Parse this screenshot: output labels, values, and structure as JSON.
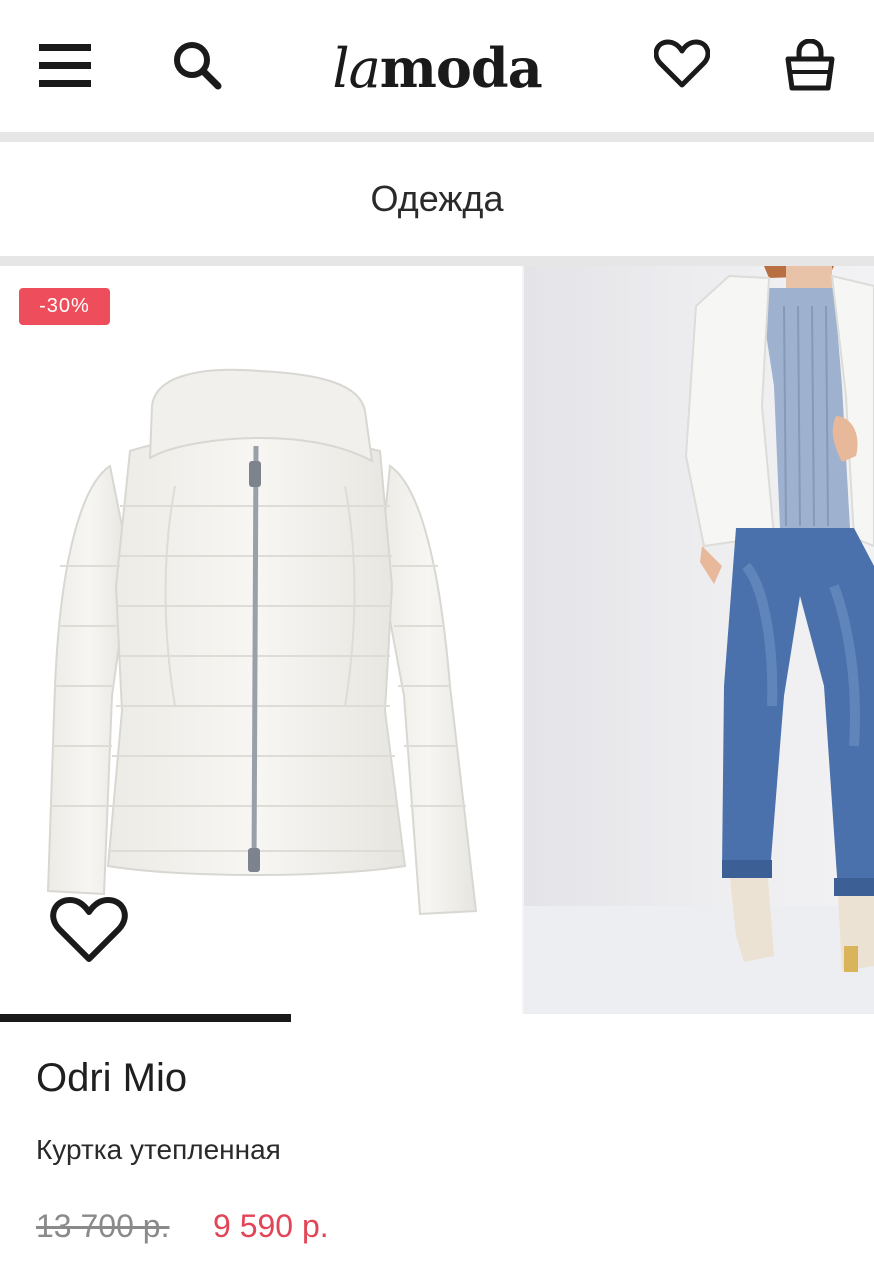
{
  "header": {
    "logo": {
      "la": "la",
      "moda": "moda"
    },
    "icons": {
      "menu": "hamburger-menu-icon",
      "search": "search-icon",
      "favorites": "heart-icon",
      "cart": "shopping-bag-icon"
    }
  },
  "category": {
    "title": "Одежда"
  },
  "product": {
    "discount_badge": "-30%",
    "brand": "Odri Mio",
    "type": "Куртка утепленная",
    "old_price": "13 700 р.",
    "new_price": "9 590 р.",
    "gallery": {
      "images": [
        "jacket-product-photo",
        "model-wearing-jacket-photo"
      ],
      "progress_fraction": 0.333
    },
    "favorite_icon": "heart-outline-icon"
  },
  "colors": {
    "badge": "#ee4e5c",
    "price_sale": "#e24557",
    "price_old": "#8a8a8a",
    "text": "#1f1f1f"
  }
}
